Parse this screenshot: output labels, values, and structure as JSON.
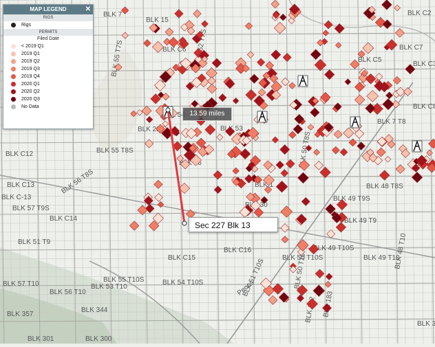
{
  "legend": {
    "title": "MAP LEGEND",
    "rigs_header": "RIGS",
    "rigs_label": "Rigs",
    "permits_header": "PERMITS",
    "permits_subheader": "Filed Date",
    "items": [
      {
        "label": "< 2019 Q1",
        "color": "#f9e2d6"
      },
      {
        "label": "2019 Q1",
        "color": "#f6c3b0"
      },
      {
        "label": "2019 Q2",
        "color": "#f3a28a"
      },
      {
        "label": "2019 Q3",
        "color": "#ef7f66"
      },
      {
        "label": "2019 Q4",
        "color": "#e35847"
      },
      {
        "label": "2020 Q1",
        "color": "#c9302c"
      },
      {
        "label": "2020 Q2",
        "color": "#a0121c"
      },
      {
        "label": "2020 Q3",
        "color": "#6e0611"
      },
      {
        "label": "No Data",
        "color": "#b9b9b9"
      }
    ]
  },
  "measure": {
    "distance": "13.59 miles",
    "section": "Sec 227 Blk 13"
  },
  "labels": [
    "BLK 7",
    "BLK 15",
    "BLK C12",
    "BLK 56 T8S",
    "BLK 55 T8S",
    "BLK C13",
    "BLK C-13",
    "BLK 57 T9S",
    "BLK 56",
    "BLK C14",
    "BLK 51 T9",
    "BLK 55 T7S",
    "BLK 52 T7S",
    "BLK 54",
    "BLK 53",
    "BLK 50 T8S",
    "BLK 1",
    "BLK 48 T8S",
    "BLK 49 T9S",
    "BLK 57 T10",
    "BLK 56 T10",
    "BLK 55 T10S",
    "BLK 54 T10S",
    "BLK 53 T10",
    "BLK C15",
    "BLK C16",
    "BLK 49 T10S",
    "BLK 50 T10S",
    "BLK 49 T10",
    "BLK 48 T10",
    "BLK 50 T10",
    "BLK 51 T10S",
    "BLK 49 T9",
    "BLK 357",
    "BLK 344",
    "BLK 301",
    "BLK 300",
    "BLK 122",
    "BLK 183",
    "BLK 3",
    "BLK C7",
    "BLK C5",
    "BLK C6",
    "BLK C8",
    "BLK 30",
    "BLK C2",
    "BLK C3",
    "BLK 22",
    "BLK 7 T8",
    "Reeves",
    "Pecos"
  ],
  "colors": {
    "grid": "#c9cac7",
    "road": "#9a9a9a",
    "measure_line": "#e0383c",
    "terrain": "#c7d3c2"
  }
}
